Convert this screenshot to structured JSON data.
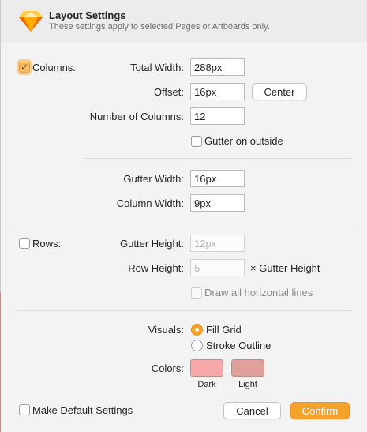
{
  "header": {
    "title": "Layout Settings",
    "subtitle": "These settings apply to selected Pages or Artboards only.",
    "logo_icon": "sketch-diamond-icon"
  },
  "columns": {
    "enabled_label": "Columns:",
    "enabled": true,
    "total_width_label": "Total Width:",
    "total_width_value": "288px",
    "offset_label": "Offset:",
    "offset_value": "16px",
    "center_button": "Center",
    "num_columns_label": "Number of Columns:",
    "num_columns_value": "12",
    "gutter_outside_label": "Gutter on outside",
    "gutter_outside_checked": false,
    "gutter_width_label": "Gutter Width:",
    "gutter_width_value": "16px",
    "column_width_label": "Column Width:",
    "column_width_value": "9px"
  },
  "rows": {
    "enabled_label": "Rows:",
    "enabled": false,
    "gutter_height_label": "Gutter Height:",
    "gutter_height_placeholder": "12px",
    "row_height_label": "Row Height:",
    "row_height_placeholder": "5",
    "row_height_suffix": "× Gutter Height",
    "draw_lines_label": "Draw all horizontal lines",
    "draw_lines_checked": false
  },
  "visuals": {
    "label": "Visuals:",
    "options": [
      {
        "label": "Fill Grid",
        "selected": true
      },
      {
        "label": "Stroke Outline",
        "selected": false
      }
    ]
  },
  "colors": {
    "label": "Colors:",
    "dark": {
      "label": "Dark",
      "color": "#f7a8a8"
    },
    "light": {
      "label": "Light",
      "color": "#e0a09c"
    }
  },
  "footer": {
    "default_settings_label": "Make Default Settings",
    "default_settings_checked": false,
    "cancel_button": "Cancel",
    "confirm_button": "Confirm"
  },
  "theme": {
    "accent": "#f5a22a"
  }
}
